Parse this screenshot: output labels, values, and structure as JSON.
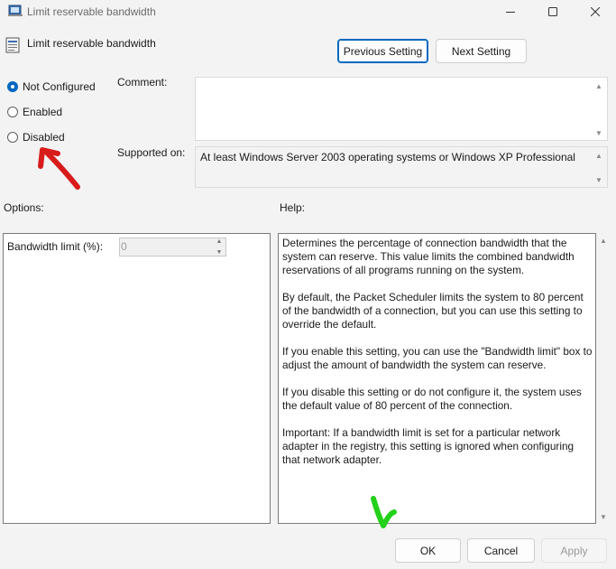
{
  "window": {
    "title": "Limit reservable bandwidth",
    "controls": {
      "minimize": "minimize-icon",
      "maximize": "maximize-icon",
      "close": "close-icon"
    }
  },
  "header": {
    "policy_name": "Limit reservable bandwidth",
    "prev_button": "Previous Setting",
    "next_button": "Next Setting"
  },
  "state": {
    "options": [
      "Not Configured",
      "Enabled",
      "Disabled"
    ],
    "selected": "Not Configured"
  },
  "comment": {
    "label": "Comment:",
    "value": ""
  },
  "supported": {
    "label": "Supported on:",
    "value": "At least Windows Server 2003 operating systems or Windows XP Professional"
  },
  "options_panel": {
    "label": "Options:",
    "bandwidth_label": "Bandwidth limit (%):",
    "bandwidth_value": "0"
  },
  "help_panel": {
    "label": "Help:",
    "paragraphs": [
      "Determines the percentage of connection bandwidth that the system can reserve. This value limits the combined bandwidth reservations of all programs running on the system.",
      "By default, the Packet Scheduler limits the system to 80 percent of the bandwidth of a connection, but you can use this setting to override the default.",
      "If you enable this setting, you can use the \"Bandwidth limit\" box to adjust the amount of bandwidth the system can reserve.",
      "If you disable this setting or do not configure it, the system uses the default value of 80 percent of the connection.",
      "Important: If a bandwidth limit is set for a particular network adapter in the registry, this setting is ignored when configuring that network adapter."
    ]
  },
  "footer": {
    "ok": "OK",
    "cancel": "Cancel",
    "apply": "Apply"
  },
  "annotations": {
    "red_arrow_color": "#d81b1b",
    "green_arrow_color": "#22d11a"
  },
  "colors": {
    "accent": "#0067c0",
    "window_bg": "#f3f3f3"
  }
}
